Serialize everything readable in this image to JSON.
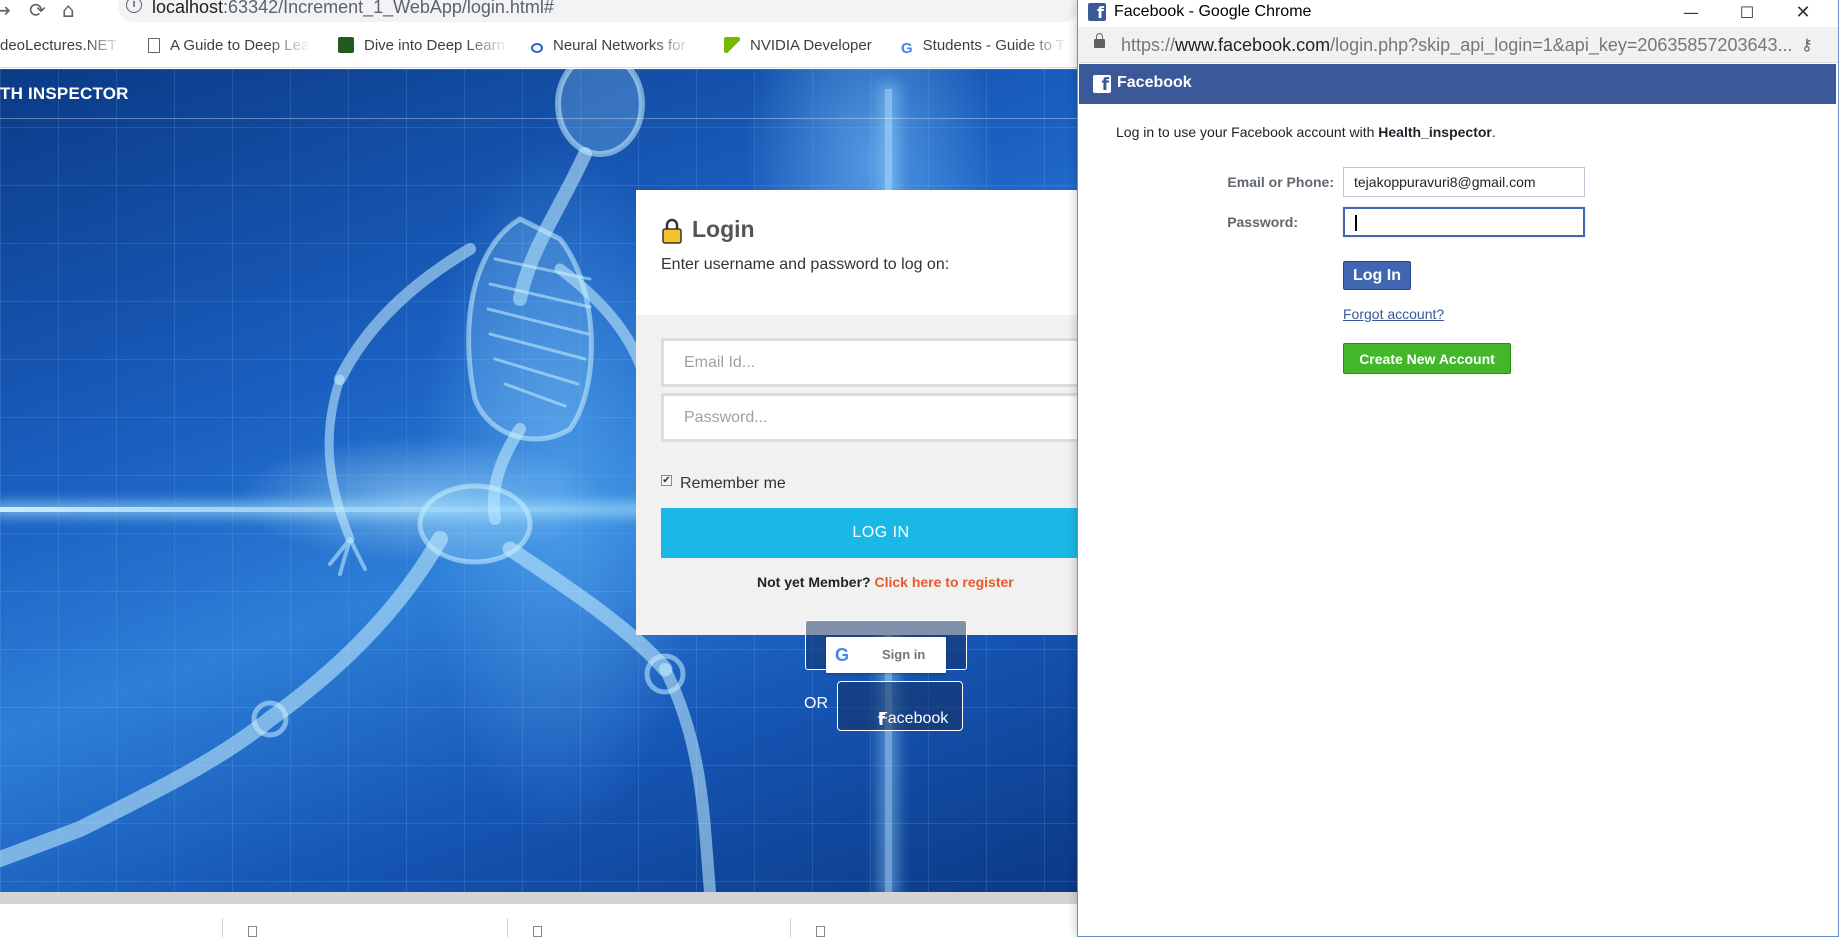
{
  "browser": {
    "url_host": "localhost",
    "url_path": ":63342/Increment_1_WebApp/login.html#",
    "bookmarks": [
      {
        "label": "deoLectures.NET -",
        "icon": "video-icon"
      },
      {
        "label": "A Guide to Deep Lear",
        "icon": "document-icon"
      },
      {
        "label": "Dive into Deep Learn",
        "icon": "d2l-icon"
      },
      {
        "label": "Neural Networks for",
        "icon": "infinity-icon"
      },
      {
        "label": "NVIDIA Developer",
        "icon": "nvidia-icon"
      },
      {
        "label": "Students - Guide to T",
        "icon": "google-icon"
      }
    ]
  },
  "app": {
    "brand": "TH INSPECTOR",
    "login": {
      "title": "Login",
      "subtitle": "Enter username and password to log on:",
      "email_placeholder": "Email Id...",
      "password_placeholder": "Password...",
      "remember_label": "Remember me",
      "remember_checked": true,
      "login_button": "LOG IN",
      "register_prompt": "Not yet Member?",
      "register_link": "Click here to register"
    },
    "social": {
      "google_label": "Sign in",
      "google_letter": "G",
      "or_text": "OR",
      "facebook_label": "Facebook"
    }
  },
  "popup": {
    "window_title": "Facebook - Google Chrome",
    "url_scheme": "https://",
    "url_host": "www.facebook.com",
    "url_rest": "/login.php?skip_api_login=1&api_key=20635857203643...",
    "header": "Facebook",
    "intro_prefix": "Log in to use your Facebook account with ",
    "app_name": "Health_inspector",
    "intro_suffix": ".",
    "email_label": "Email or Phone:",
    "email_value": "tejakoppuravuri8@gmail.com",
    "password_label": "Password:",
    "password_value": "",
    "login_button": "Log In",
    "forgot_link": "Forgot account?",
    "create_button": "Create New Account",
    "colors": {
      "fb_blue": "#3b5998",
      "create_green": "#42b72a",
      "accent": "#1ab8e6"
    }
  }
}
